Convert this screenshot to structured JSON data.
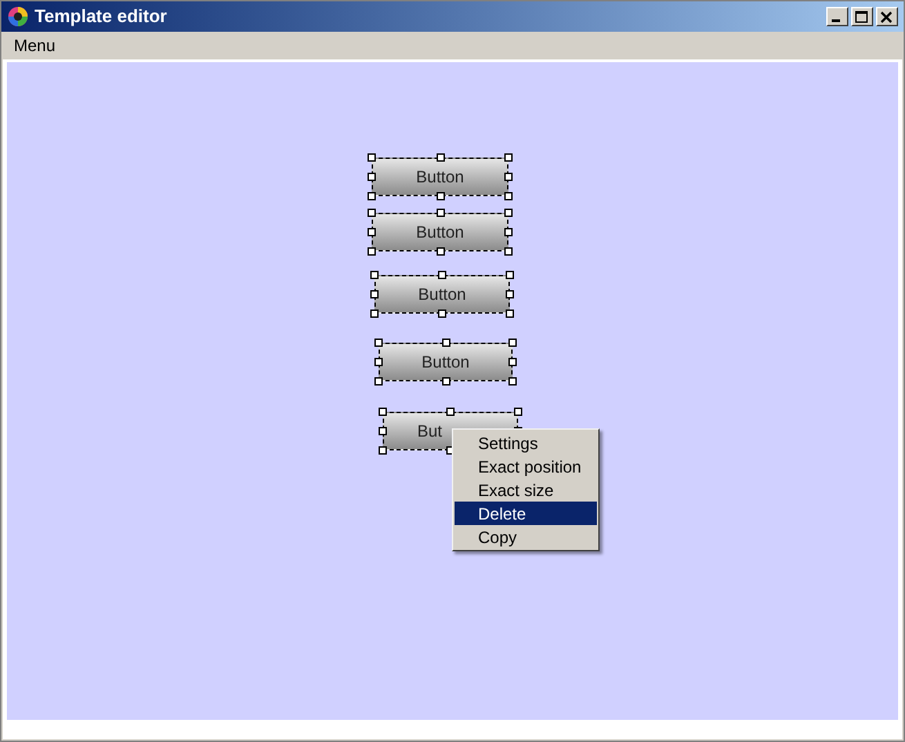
{
  "window": {
    "title": "Template editor"
  },
  "menu_bar": {
    "items": [
      {
        "label": "Menu"
      }
    ]
  },
  "canvas": {
    "buttons": [
      {
        "label": "Button",
        "selected": true
      },
      {
        "label": "Button",
        "selected": true
      },
      {
        "label": "Button",
        "selected": true
      },
      {
        "label": "Button",
        "selected": true
      },
      {
        "label": "But",
        "selected": true
      }
    ]
  },
  "context_menu": {
    "items": [
      {
        "label": "Settings",
        "selected": false
      },
      {
        "label": "Exact position",
        "selected": false
      },
      {
        "label": "Exact size",
        "selected": false
      },
      {
        "label": "Delete",
        "selected": true
      },
      {
        "label": "Copy",
        "selected": false
      }
    ]
  }
}
